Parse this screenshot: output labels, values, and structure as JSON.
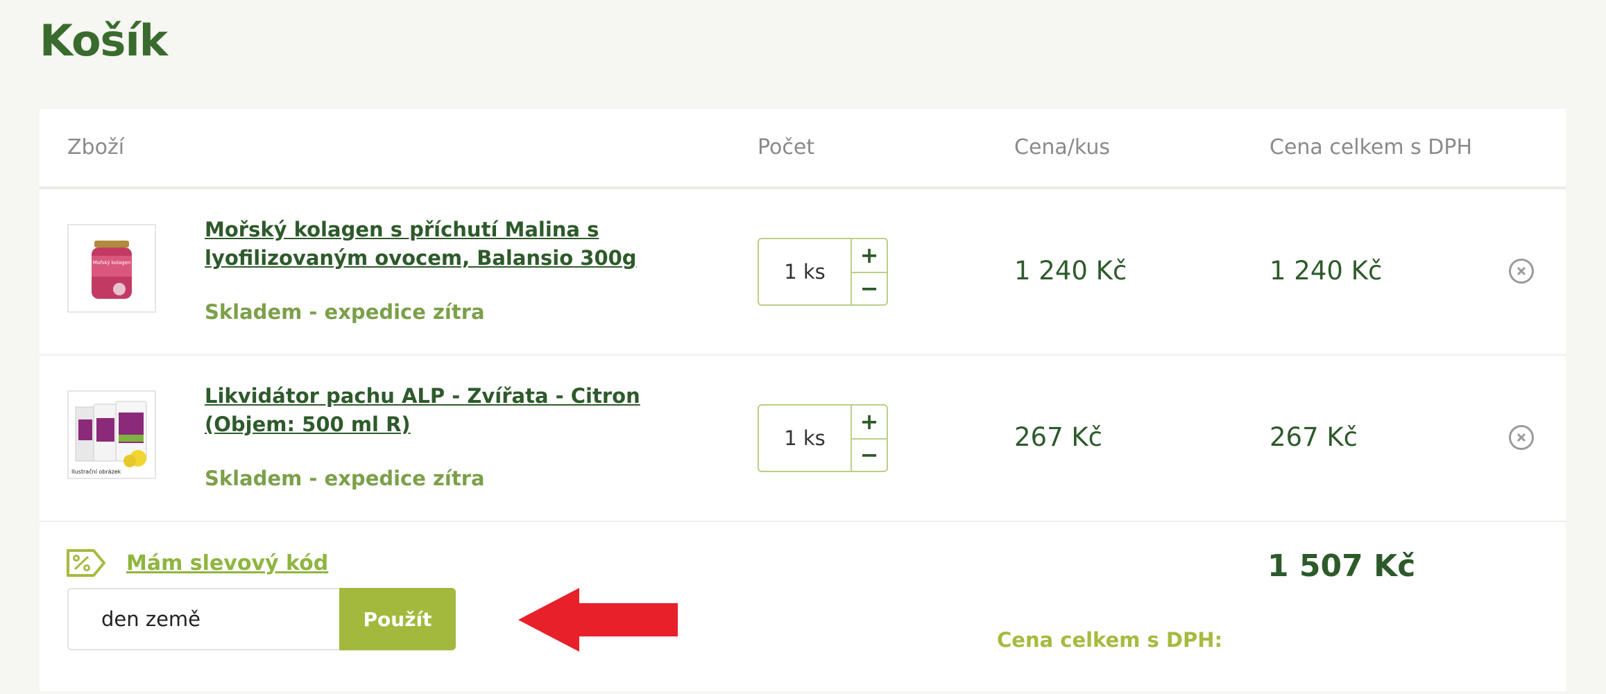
{
  "page": {
    "title": "Košík"
  },
  "cart": {
    "headers": {
      "product": "Zboží",
      "quantity": "Počet",
      "unit_price": "Cena/kus",
      "total_price": "Cena celkem s DPH"
    },
    "items": [
      {
        "name": "Mořský kolagen s příchutí Malina s lyofilizovaným ovocem, Balansio 300g",
        "stock": "Skladem - expedice zítra",
        "quantity": "1 ks",
        "unit_price": "1 240 Kč",
        "total_price": "1 240 Kč",
        "image_label": "Mořský kolagen",
        "plus": "+",
        "minus": "−"
      },
      {
        "name": "Likvidátor pachu ALP - Zvířata - Citron (Objem: 500 ml R)",
        "stock": "Skladem - expedice zítra",
        "quantity": "1 ks",
        "unit_price": "267 Kč",
        "total_price": "267 Kč",
        "image_label": "Ilustrační obrázek",
        "plus": "+",
        "minus": "−"
      }
    ],
    "coupon": {
      "link_text": "Mám slevový kód",
      "input_value": "den země",
      "apply_label": "Použít"
    },
    "total": {
      "label": "Cena celkem s DPH:",
      "value": "1 507 Kč"
    }
  },
  "colors": {
    "title": "#3a6b2e",
    "product_link": "#2e5a2b",
    "stock": "#7ca04a",
    "accent": "#a2b93e",
    "arrow": "#e8202a"
  }
}
